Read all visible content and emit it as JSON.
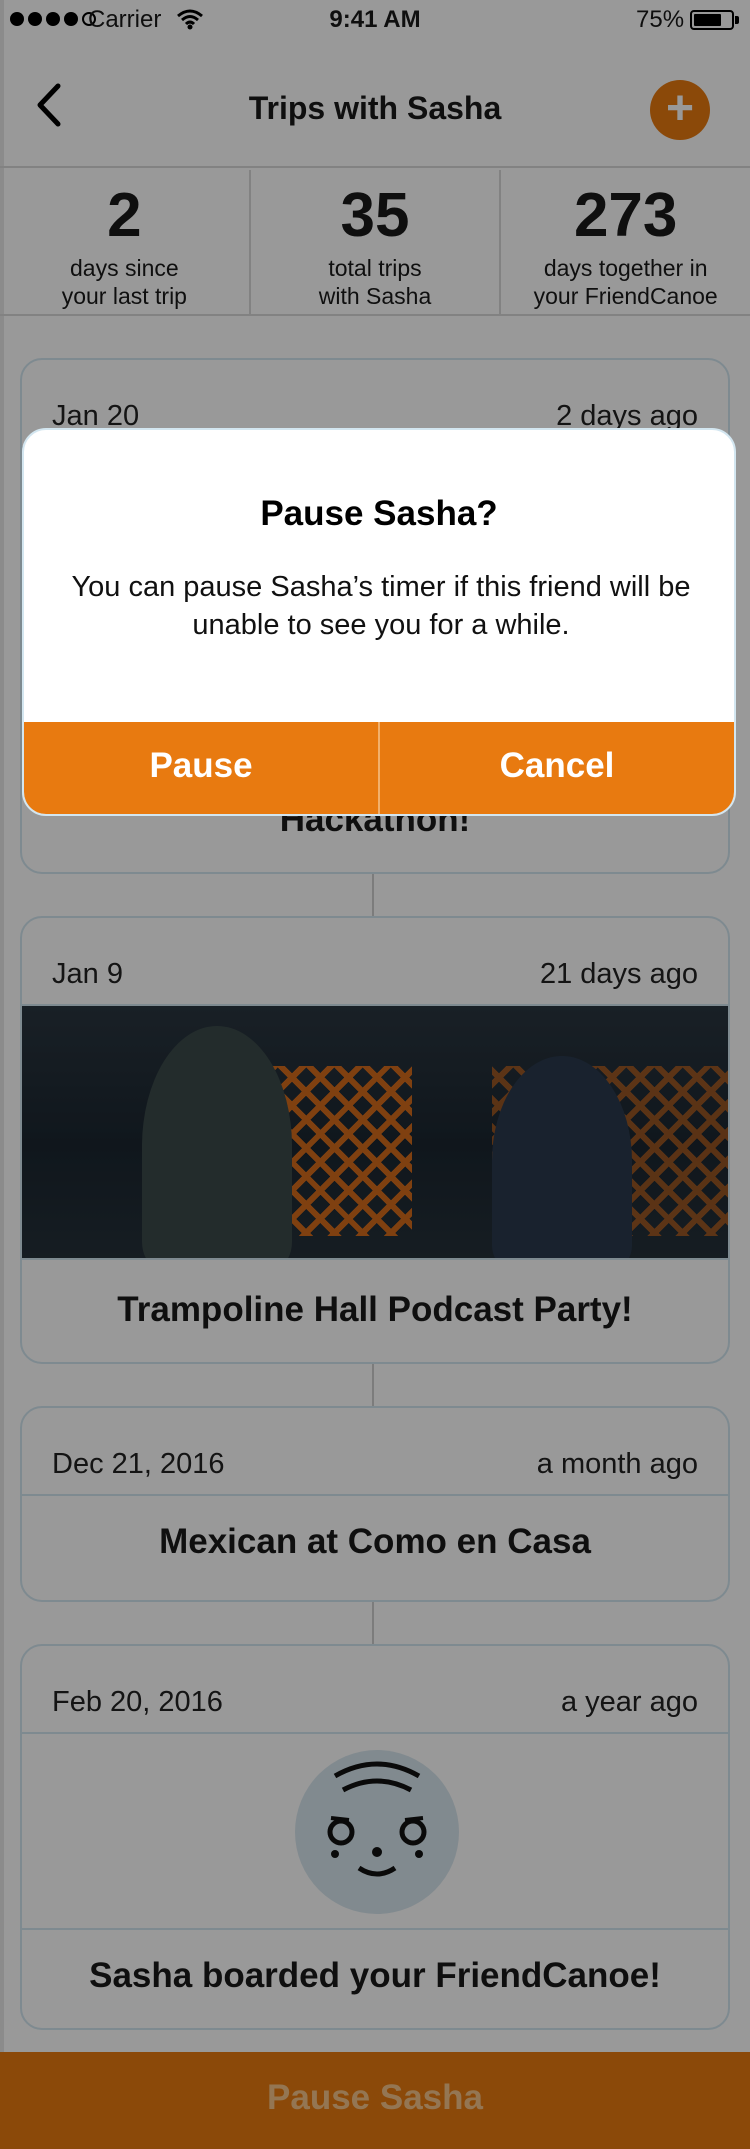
{
  "status_bar": {
    "carrier": "Carrier",
    "time": "9:41 AM",
    "battery": "75%",
    "battery_level": 0.75
  },
  "nav": {
    "title": "Trips with Sasha",
    "add_icon": "plus-icon",
    "back_icon": "chevron-left-icon"
  },
  "stats": [
    {
      "value": "2",
      "label_line1": "days since",
      "label_line2": "your last trip"
    },
    {
      "value": "35",
      "label_line1": "total trips",
      "label_line2": "with Sasha"
    },
    {
      "value": "273",
      "label_line1": "days together in",
      "label_line2": "your FriendCanoe"
    }
  ],
  "trips": [
    {
      "date": "Jan 20",
      "ago": "2 days ago",
      "title": "Hackathon!"
    },
    {
      "date": "Jan 9",
      "ago": "21 days ago",
      "title": "Trampoline Hall Podcast Party!"
    },
    {
      "date": "Dec 21, 2016",
      "ago": "a month ago",
      "title": "Mexican at Como en Casa"
    },
    {
      "date": "Feb 20, 2016",
      "ago": "a year ago",
      "title": "Sasha boarded your FriendCanoe!"
    }
  ],
  "bottom_button": "Pause Sasha",
  "dialog": {
    "title": "Pause Sasha?",
    "message": "You can pause Sasha’s timer if this friend will be unable to see you for a while.",
    "confirm": "Pause",
    "cancel": "Cancel"
  },
  "colors": {
    "accent": "#e87a10",
    "card_border": "#d3e6f0",
    "overlay": "rgba(0,0,0,0.4)"
  }
}
